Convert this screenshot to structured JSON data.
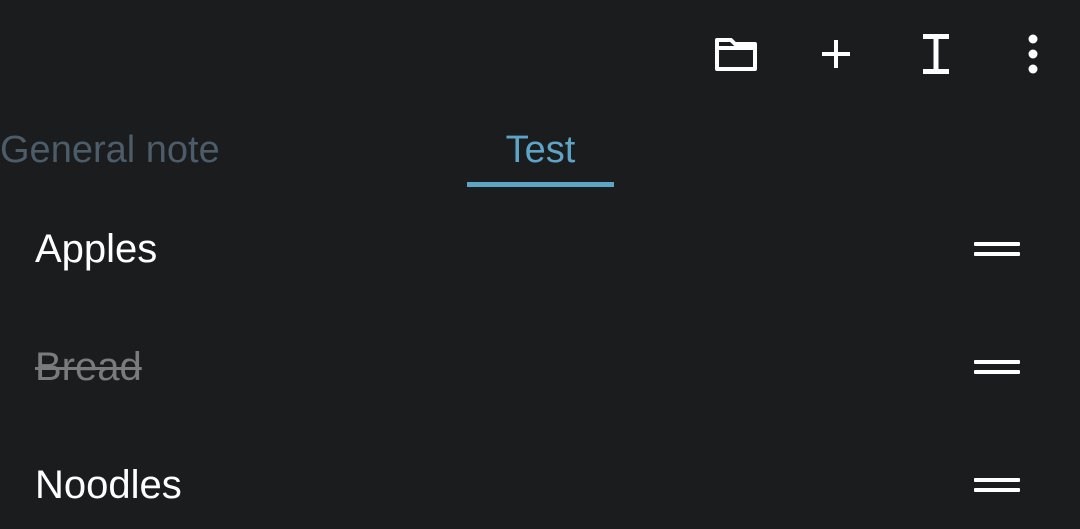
{
  "toolbar": {
    "buttons": [
      {
        "icon": "folder-icon"
      },
      {
        "icon": "plus-icon"
      },
      {
        "icon": "text-cursor-icon"
      },
      {
        "icon": "more-vert-icon"
      }
    ]
  },
  "tabs": [
    {
      "label": "General note",
      "active": false
    },
    {
      "label": "Test",
      "active": true
    }
  ],
  "list": {
    "items": [
      {
        "label": "Apples",
        "checked": false
      },
      {
        "label": "Bread",
        "checked": true
      },
      {
        "label": "Noodles",
        "checked": false
      }
    ]
  },
  "colors": {
    "background": "#1b1c1e",
    "accent": "#5da4c6",
    "inactive_tab": "#4c5c68",
    "checked_text": "#7a7b7d",
    "text": "#ffffff"
  }
}
